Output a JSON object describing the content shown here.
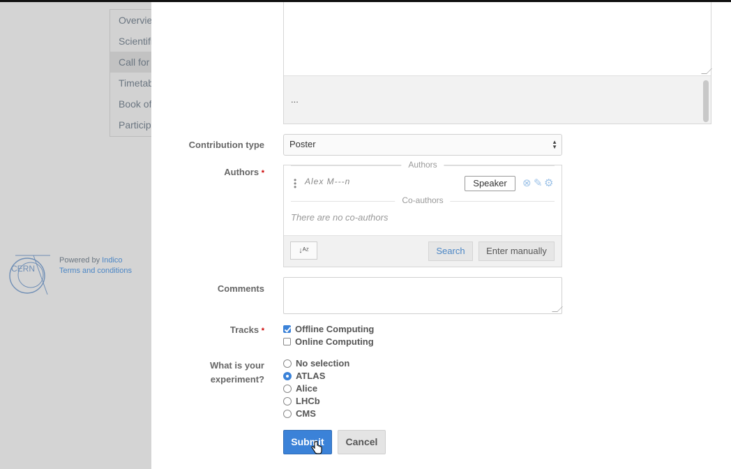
{
  "background": {
    "menu_items": [
      "Overview",
      "Scientific Programme",
      "Call for Abstracts",
      "Timetable",
      "Book of Abstracts",
      "Participant List"
    ],
    "active_index": 2,
    "footer": {
      "logo_text": "CERN",
      "powered_prefix": "Powered by ",
      "powered_link": "Indico",
      "terms_link": "Terms and conditions"
    }
  },
  "form": {
    "description": {
      "preview_text": "..."
    },
    "contribution_type": {
      "label": "Contribution type",
      "value": "Poster"
    },
    "authors": {
      "label": "Authors",
      "required_mark": "*",
      "authors_heading": "Authors",
      "author_name": "Alex M---n",
      "speaker_label": "Speaker",
      "coauthors_heading": "Co-authors",
      "no_coauthors": "There are no co-authors",
      "search_label": "Search",
      "enter_manually_label": "Enter manually"
    },
    "comments": {
      "label": "Comments",
      "value": ""
    },
    "tracks": {
      "label": "Tracks",
      "required_mark": "*",
      "options": [
        {
          "label": "Offline Computing",
          "checked": true
        },
        {
          "label": "Online Computing",
          "checked": false
        }
      ]
    },
    "experiment": {
      "label_line1": "What is your",
      "label_line2": "experiment?",
      "options": [
        "No selection",
        "ATLAS",
        "Alice",
        "LHCb",
        "CMS"
      ],
      "selected": "ATLAS"
    },
    "submit_label": "Submit",
    "cancel_label": "Cancel"
  },
  "colors": {
    "accent": "#3b82d8",
    "link": "#4b86c5",
    "required": "#cc0000"
  }
}
